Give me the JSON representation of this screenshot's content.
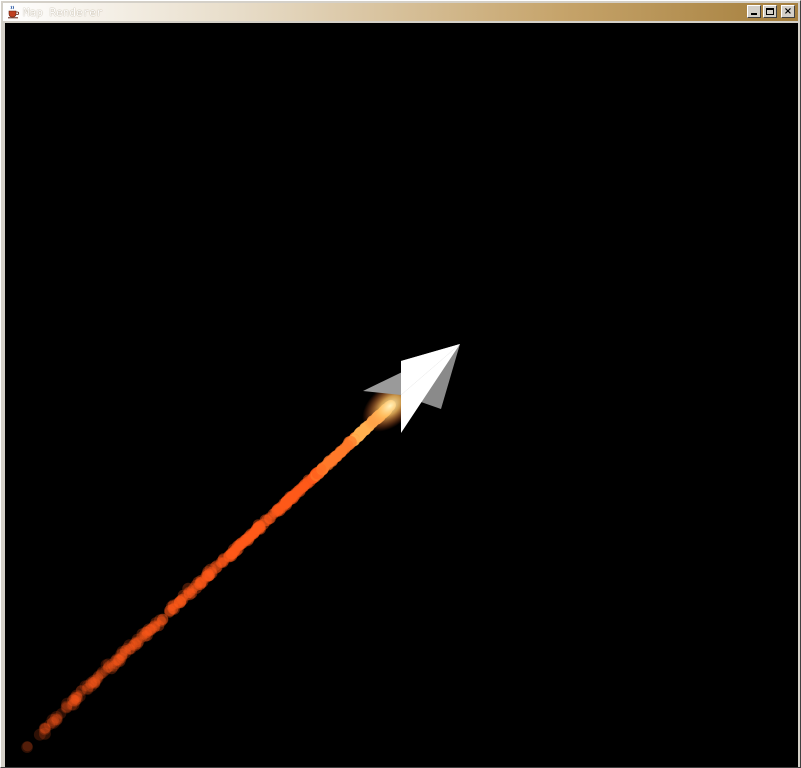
{
  "window": {
    "title": "Map Renderer",
    "minimize_label": "_",
    "maximize_label": "□",
    "close_label": "×"
  },
  "colors": {
    "titlebar_start": "#ffffff",
    "titlebar_end": "#a57f3d",
    "canvas_background": "#000000",
    "particle": "#ff5a1a",
    "particle_core": "#ffd27a",
    "ship": "#ffffff",
    "ship_shadow": "#9a9a9a"
  },
  "icons": {
    "app": "java-cup-icon",
    "minimize": "minimize-icon",
    "maximize": "maximize-icon",
    "close": "close-icon"
  }
}
